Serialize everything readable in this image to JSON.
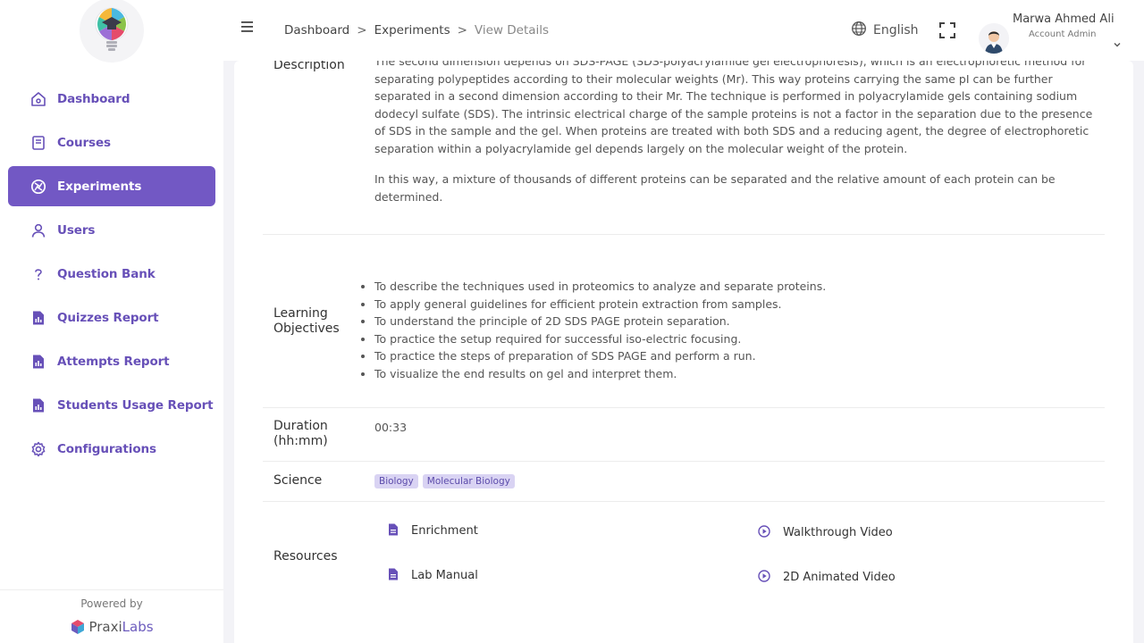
{
  "header": {
    "breadcrumb": [
      "Dashboard",
      "Experiments",
      "View Details"
    ],
    "separator": ">",
    "language": "English",
    "user_name": "Marwa Ahmed Ali",
    "user_role": "Account Admin"
  },
  "sidebar": {
    "items": [
      {
        "label": "Dashboard",
        "icon": "home-icon"
      },
      {
        "label": "Courses",
        "icon": "book-icon"
      },
      {
        "label": "Experiments",
        "icon": "aperture-icon",
        "active": true
      },
      {
        "label": "Users",
        "icon": "user-icon"
      },
      {
        "label": "Question Bank",
        "icon": "question-icon"
      },
      {
        "label": "Quizzes Report",
        "icon": "report-icon"
      },
      {
        "label": "Attempts Report",
        "icon": "report-icon"
      },
      {
        "label": "Students Usage Report",
        "icon": "report-icon"
      },
      {
        "label": "Configurations",
        "icon": "gear-icon"
      }
    ],
    "powered_by": "Powered by",
    "brand_praxi": "Praxi",
    "brand_labs": "Labs"
  },
  "details": {
    "description_label": "Description",
    "description_p1": "The second dimension depends on SDS-PAGE (SDS-polyacrylamide gel electrophoresis), which is an electrophoretic method for separating polypeptides according to their molecular weights (Mr). This way proteins carrying the same pI can be further separated in a second dimension according to their Mr. The technique is performed in polyacrylamide gels containing sodium dodecyl sulfate (SDS). The intrinsic electrical charge of the sample proteins is not a factor in the separation due to the presence of SDS in the sample and the gel. When proteins are treated with both SDS and a reducing agent, the degree of electrophoretic separation within a polyacrylamide gel depends largely on the molecular weight of the protein.",
    "description_p2": "In this way, a mixture of thousands of different proteins can be separated and the relative amount of each protein can be determined.",
    "objectives_label": "Learning Objectives",
    "objectives": [
      "To describe the techniques used in proteomics to analyze and separate proteins.",
      "To apply general guidelines for efficient protein extraction from samples.",
      "To understand the principle of 2D SDS PAGE protein separation.",
      "To practice the setup required for successful iso-electric focusing.",
      "To practice the steps of preparation of SDS PAGE and perform a run.",
      "To visualize the end results on gel and interpret them."
    ],
    "duration_label": "Duration (hh:mm)",
    "duration_value": "00:33",
    "science_label": "Science",
    "science_tags": [
      "Biology",
      "Molecular Biology"
    ],
    "resources_label": "Resources",
    "resources": [
      {
        "label": "Enrichment",
        "icon": "document-icon"
      },
      {
        "label": "Walkthrough Video",
        "icon": "play-icon"
      },
      {
        "label": "Lab Manual",
        "icon": "document-icon"
      },
      {
        "label": "2D Animated Video",
        "icon": "play-icon"
      }
    ]
  },
  "colors": {
    "accent": "#7258c4",
    "accent_text": "#6750b8",
    "tag_bg": "#d9d3f3"
  }
}
